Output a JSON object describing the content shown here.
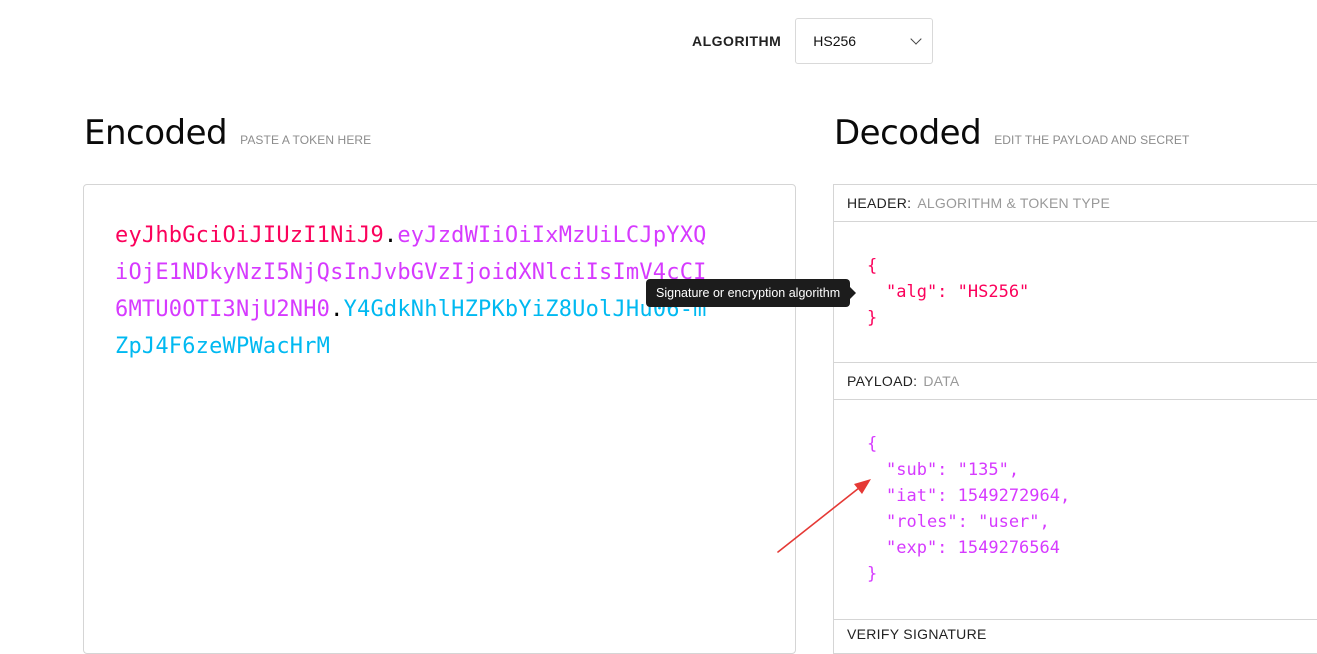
{
  "algorithm": {
    "label": "ALGORITHM",
    "selected": "HS256"
  },
  "encoded": {
    "title": "Encoded",
    "subtitle": "PASTE A TOKEN HERE",
    "token_header": "eyJhbGciOiJIUzI1NiJ9",
    "token_payload": "eyJzdWIiOiIxMzUiLCJpYXQiOjE1NDkyNzI5NjQsInJvbGVzIjoidXNlciIsImV4cCI6MTU0OTI3NjU2NH0",
    "token_signature": "Y4GdkNhlHZPKbYiZ8UolJHu06-mZpJ4F6zeWPWacHrM",
    "separator": "."
  },
  "decoded": {
    "title": "Decoded",
    "subtitle": "EDIT THE PAYLOAD AND SECRET",
    "header_panel": {
      "label": "HEADER:",
      "description": "ALGORITHM & TOKEN TYPE",
      "lines": [
        "{",
        "\"alg\": \"HS256\"",
        "}"
      ]
    },
    "payload_panel": {
      "label": "PAYLOAD:",
      "description": "DATA",
      "lines": [
        "{",
        "\"sub\": \"135\",",
        "\"iat\": 1549272964,",
        "\"roles\": \"user\",",
        "\"exp\": 1549276564",
        "}"
      ]
    },
    "signature_panel": {
      "label": "VERIFY SIGNATURE"
    }
  },
  "tooltip": {
    "text": "Signature or encryption algorithm"
  },
  "colors": {
    "header": "#fb015b",
    "payload": "#d63aff",
    "signature": "#00b9f1",
    "annotation_arrow": "#e53935"
  },
  "icons": {
    "select_chevron": "chevron-down-icon",
    "annotation": "arrow-annotation-icon"
  }
}
